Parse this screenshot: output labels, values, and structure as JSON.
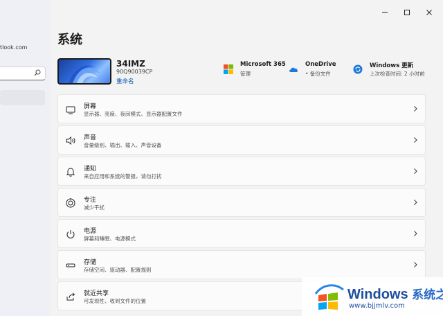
{
  "sidebar": {
    "account_email": "tlook.com",
    "search_placeholder": ""
  },
  "page": {
    "title": "系统"
  },
  "device": {
    "name": "34IMZ",
    "model": "90Q90039CP",
    "rename": "重命名"
  },
  "quick": [
    {
      "title": "Microsoft 365",
      "subtitle": "管理",
      "icon": "microsoft-365-icon"
    },
    {
      "title": "OneDrive",
      "subtitle": "• 备份文件",
      "icon": "onedrive-cloud-icon"
    },
    {
      "title": "Windows 更新",
      "subtitle": "上次检查时间: 2 小时前",
      "icon": "windows-update-icon"
    }
  ],
  "settings": [
    {
      "title": "屏幕",
      "subtitle": "显示器、亮度、夜间模式、显示器配置文件",
      "icon": "display-icon"
    },
    {
      "title": "声音",
      "subtitle": "音量级别、输出、输入、声音设备",
      "icon": "speaker-icon"
    },
    {
      "title": "通知",
      "subtitle": "来自应用和系统的警报，请勿打扰",
      "icon": "bell-icon"
    },
    {
      "title": "专注",
      "subtitle": "减少干扰",
      "icon": "focus-icon"
    },
    {
      "title": "电源",
      "subtitle": "屏幕和睡眠、电源模式",
      "icon": "power-icon"
    },
    {
      "title": "存储",
      "subtitle": "存储空间、驱动器、配置规则",
      "icon": "storage-icon"
    },
    {
      "title": "就近共享",
      "subtitle": "可发现性、收到文件的位置",
      "icon": "share-icon"
    }
  ],
  "watermark": {
    "title": "Windows",
    "title_cn": "系统之家",
    "url": "www.bjjmlv.com"
  },
  "colors": {
    "accent": "#0b5cad",
    "window_bg": "#f3f3f3",
    "card_bg": "#fbfbfb",
    "watermark_blue": "#1d4f9e"
  }
}
